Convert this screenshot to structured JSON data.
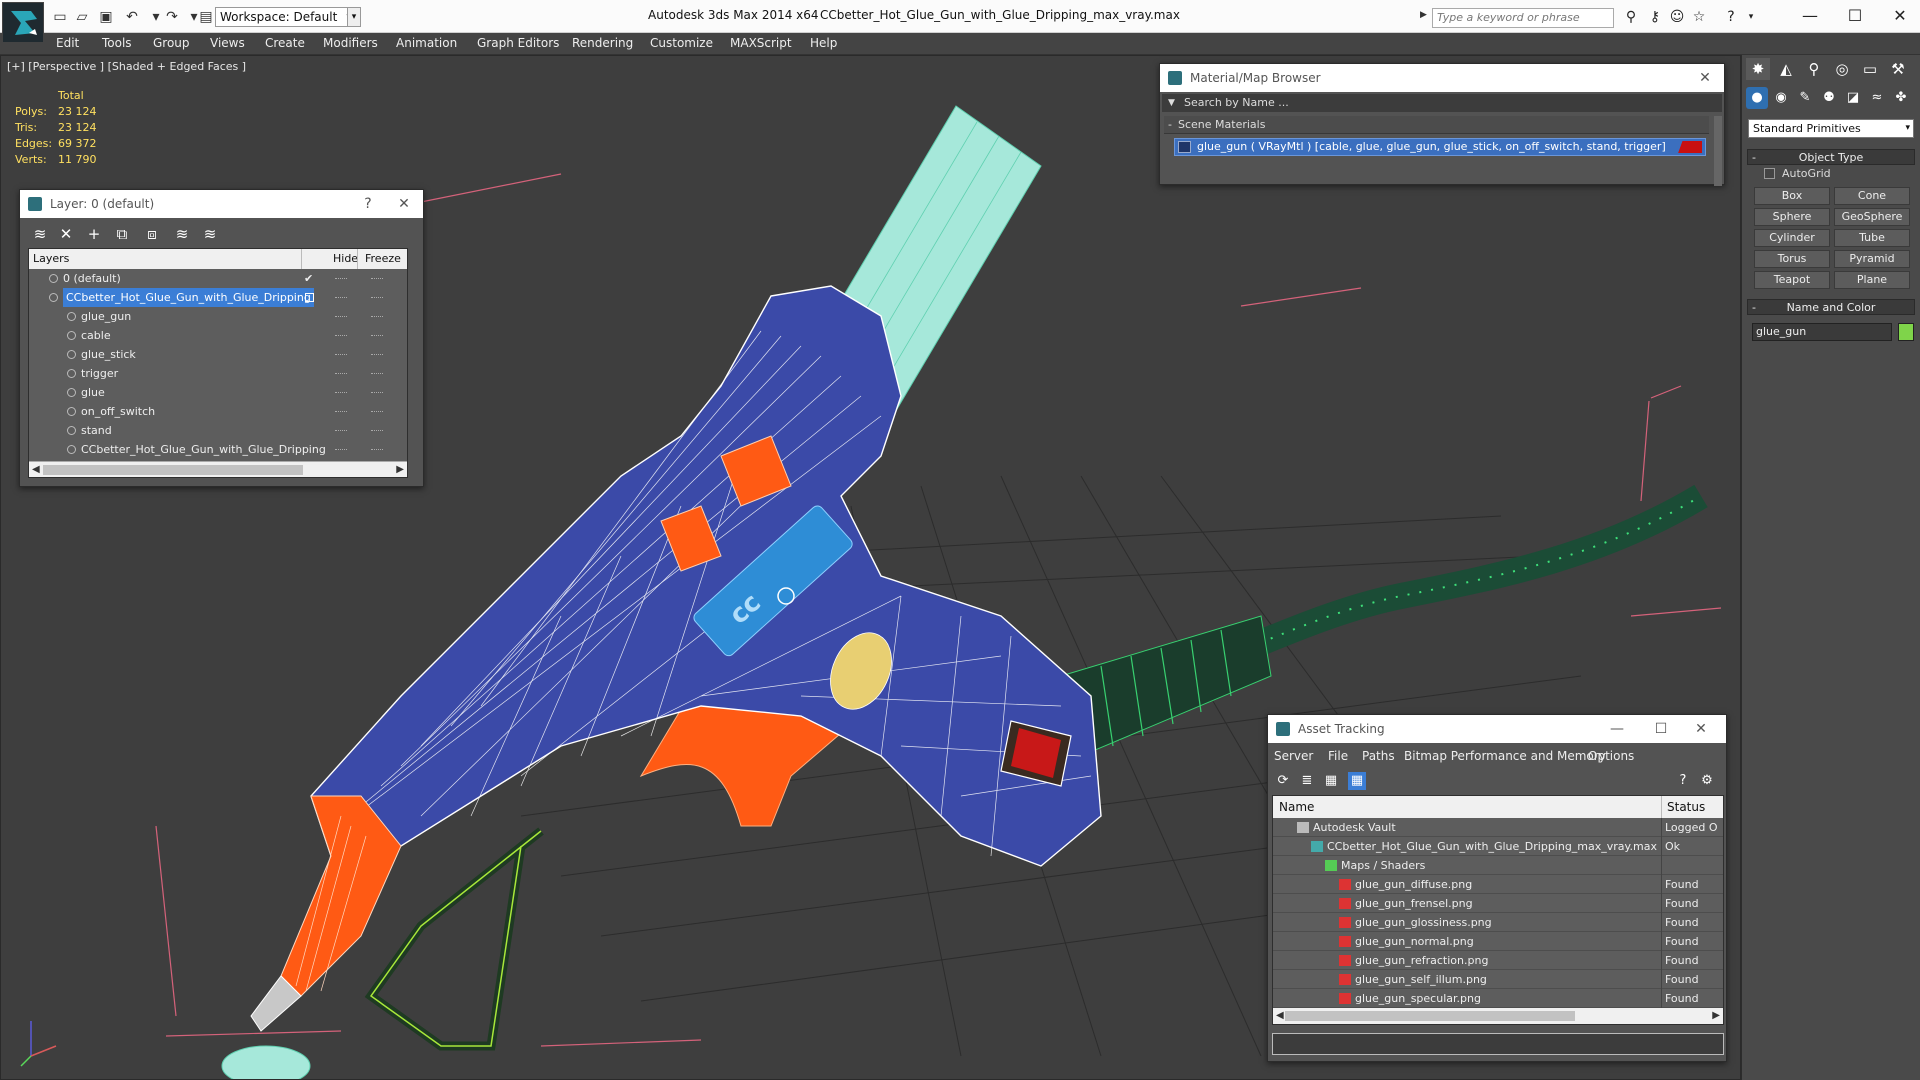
{
  "titlebar": {
    "workspace_label": "Workspace: Default",
    "app_title": "Autodesk 3ds Max  2014 x64",
    "file_title": "CCbetter_Hot_Glue_Gun_with_Glue_Dripping_max_vray.max",
    "search_placeholder": "Type a keyword or phrase"
  },
  "menu": [
    "Edit",
    "Tools",
    "Group",
    "Views",
    "Create",
    "Modifiers",
    "Animation",
    "Graph Editors",
    "Rendering",
    "Customize",
    "MAXScript",
    "Help"
  ],
  "viewport": {
    "label": "[+] [Perspective ] [Shaded + Edged Faces ]",
    "stats": {
      "total_label": "Total",
      "rows": [
        {
          "label": "Polys:",
          "value": "23 124"
        },
        {
          "label": "Tris:",
          "value": "23 124"
        },
        {
          "label": "Edges:",
          "value": "69 372"
        },
        {
          "label": "Verts:",
          "value": "11 790"
        }
      ]
    }
  },
  "layer_window": {
    "title": "Layer: 0 (default)",
    "help": "?",
    "close": "✕",
    "columns": {
      "layers": "Layers",
      "hide": "Hide",
      "freeze": "Freeze"
    },
    "rows": [
      {
        "name": "0 (default)",
        "level": 0,
        "checked": true
      },
      {
        "name": "CCbetter_Hot_Glue_Gun_with_Glue_Dripping",
        "level": 0,
        "selected": true
      },
      {
        "name": "glue_gun",
        "level": 1
      },
      {
        "name": "cable",
        "level": 1
      },
      {
        "name": "glue_stick",
        "level": 1
      },
      {
        "name": "trigger",
        "level": 1
      },
      {
        "name": "glue",
        "level": 1
      },
      {
        "name": "on_off_switch",
        "level": 1
      },
      {
        "name": "stand",
        "level": 1
      },
      {
        "name": "CCbetter_Hot_Glue_Gun_with_Glue_Dripping",
        "level": 1
      }
    ]
  },
  "material_browser": {
    "title": "Material/Map Browser",
    "close": "✕",
    "search_placeholder": "Search by Name ...",
    "section": "Scene Materials",
    "item": "glue_gun  ( VRayMtl ) [cable, glue, glue_gun, glue_stick, on_off_switch, stand, trigger]"
  },
  "asset_tracking": {
    "title": "Asset Tracking",
    "menu": [
      "Server",
      "File",
      "Paths",
      "Bitmap Performance and Memory",
      "Options"
    ],
    "columns": {
      "name": "Name",
      "status": "Status"
    },
    "rows": [
      {
        "name": "Autodesk Vault",
        "status": "Logged O",
        "level": 0,
        "icon": "vault"
      },
      {
        "name": "CCbetter_Hot_Glue_Gun_with_Glue_Dripping_max_vray.max",
        "status": "Ok",
        "level": 1,
        "icon": "max"
      },
      {
        "name": "Maps / Shaders",
        "status": "",
        "level": 2,
        "icon": "maps"
      },
      {
        "name": "glue_gun_diffuse.png",
        "status": "Found",
        "level": 3,
        "icon": "png"
      },
      {
        "name": "glue_gun_frensel.png",
        "status": "Found",
        "level": 3,
        "icon": "png"
      },
      {
        "name": "glue_gun_glossiness.png",
        "status": "Found",
        "level": 3,
        "icon": "png"
      },
      {
        "name": "glue_gun_normal.png",
        "status": "Found",
        "level": 3,
        "icon": "png"
      },
      {
        "name": "glue_gun_refraction.png",
        "status": "Found",
        "level": 3,
        "icon": "png"
      },
      {
        "name": "glue_gun_self_illum.png",
        "status": "Found",
        "level": 3,
        "icon": "png"
      },
      {
        "name": "glue_gun_specular.png",
        "status": "Found",
        "level": 3,
        "icon": "png"
      }
    ]
  },
  "command_panel": {
    "primitive_type": "Standard Primitives",
    "object_type_title": "Object Type",
    "autogrid": "AutoGrid",
    "primitives": [
      "Box",
      "Cone",
      "Sphere",
      "GeoSphere",
      "Cylinder",
      "Tube",
      "Torus",
      "Pyramid",
      "Teapot",
      "Plane"
    ],
    "name_color_title": "Name and Color",
    "object_name": "glue_gun",
    "object_color": "#7fd44a"
  },
  "colors": {
    "body_blue": "#3b4aa8",
    "trigger_orange": "#ff5a14",
    "stick_cyan": "#9fe8d8",
    "cable_green": "#1f4f3a",
    "selection_blue": "#3b7ed6"
  }
}
